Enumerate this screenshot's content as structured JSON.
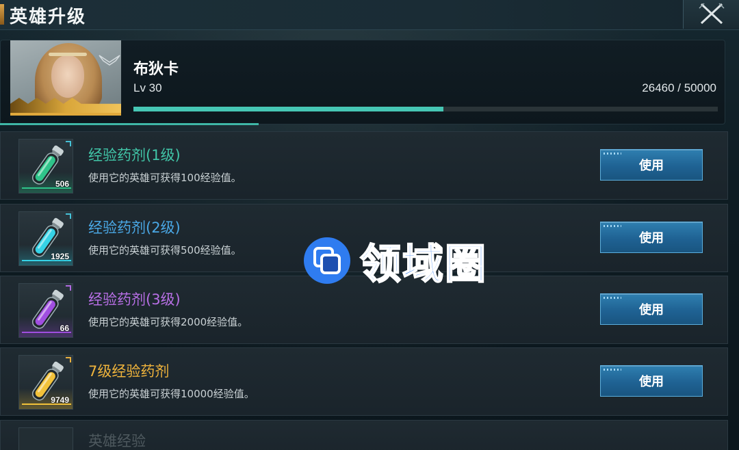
{
  "header": {
    "title": "英雄升级"
  },
  "hero": {
    "name": "布狄卡",
    "level": "Lv 30",
    "exp_text": "26460 / 50000",
    "exp_progress": 0.53
  },
  "items": [
    {
      "name": "经验药剂(1级)",
      "desc": "使用它的英雄可获得100经验值。",
      "count": "506",
      "button": "使用",
      "name_color": "#41c6a8",
      "vial_color": "#2fc48a",
      "corner_color": "#45c2d8"
    },
    {
      "name": "经验药剂(2级)",
      "desc": "使用它的英雄可获得500经验值。",
      "count": "1925",
      "button": "使用",
      "name_color": "#4aa8e6",
      "vial_color": "#36d2e6",
      "corner_color": "#45c2d8"
    },
    {
      "name": "经验药剂(3级)",
      "desc": "使用它的英雄可获得2000经验值。",
      "count": "66",
      "button": "使用",
      "name_color": "#b86fe6",
      "vial_color": "#a04ee0",
      "corner_color": "#b06ae0"
    },
    {
      "name": "7级经验药剂",
      "desc": "使用它的英雄可获得10000经验值。",
      "count": "9749",
      "button": "使用",
      "name_color": "#f0b43c",
      "vial_color": "#f2c23a",
      "corner_color": "#e8b040"
    }
  ],
  "partial_item": {
    "name": "英雄经验"
  },
  "watermark": {
    "text": "领域圈"
  },
  "icons": {
    "close": "close-icon",
    "wing": "wing-emblem-icon",
    "vial": "potion-vial-icon",
    "watermark_logo": "watermark-logo-icon"
  }
}
